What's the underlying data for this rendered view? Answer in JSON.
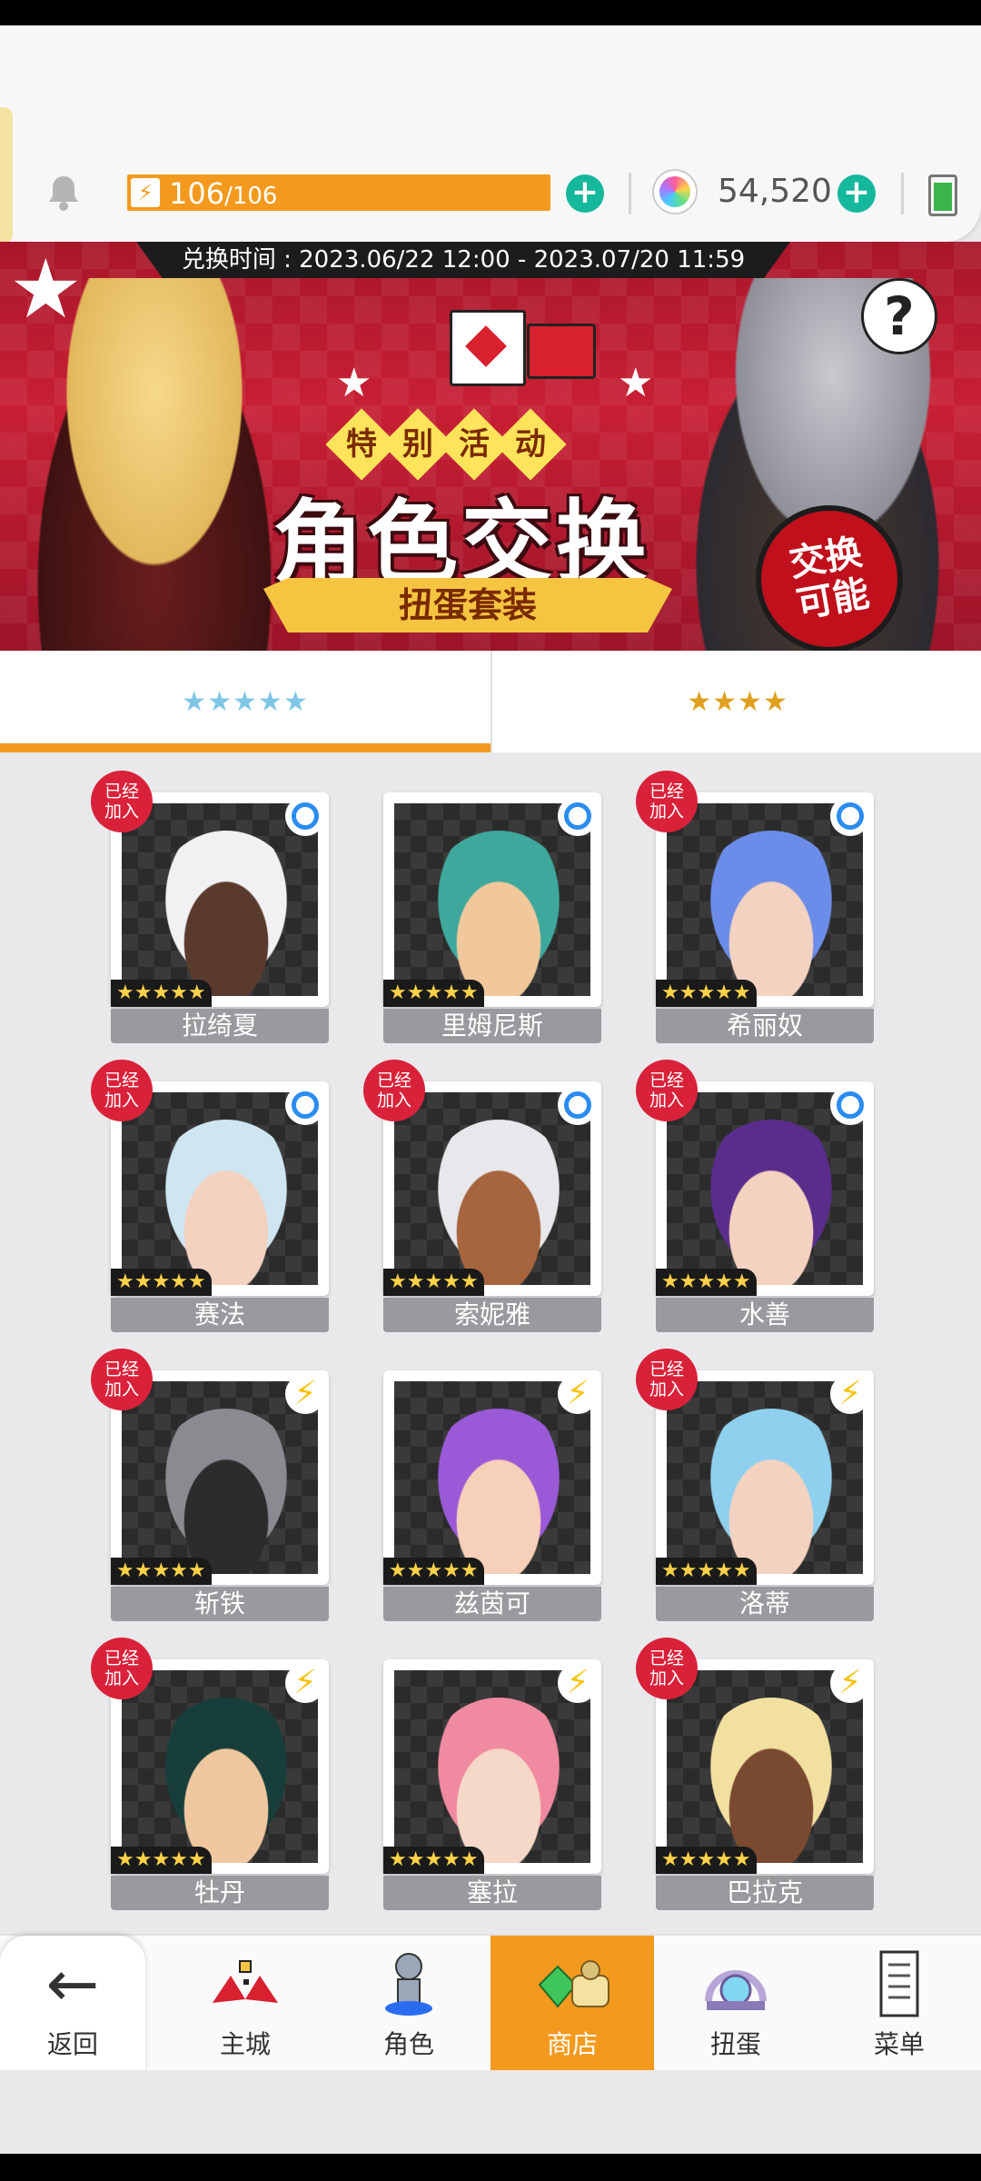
{
  "header": {
    "stamina_current": "106",
    "stamina_max": "/106",
    "gems": "54,520"
  },
  "banner": {
    "exchange_time": "兑换时间 : 2023.06/22 12:00 - 2023.07/20 11:59",
    "event_chars": [
      "特",
      "别",
      "活",
      "动"
    ],
    "title": "角色交换",
    "ribbon": "扭蛋套装",
    "stamp_line1": "交换",
    "stamp_line2": "可能"
  },
  "tabs": [
    {
      "label": "★★★★★"
    },
    {
      "label": "★★★★"
    }
  ],
  "cards": [
    {
      "name": "拉绮夏",
      "stars": "★★★★★",
      "joined": true,
      "type": "circle-icon"
    },
    {
      "name": "里姆尼斯",
      "stars": "★★★★★",
      "joined": false,
      "type": "circle-icon"
    },
    {
      "name": "希丽奴",
      "stars": "★★★★★",
      "joined": true,
      "type": "circle-icon"
    },
    {
      "name": "赛法",
      "stars": "★★★★★",
      "joined": true,
      "type": "circle-icon"
    },
    {
      "name": "索妮雅",
      "stars": "★★★★★",
      "joined": true,
      "type": "circle-icon"
    },
    {
      "name": "水善",
      "stars": "★★★★★",
      "joined": true,
      "type": "circle-icon"
    },
    {
      "name": "斩铁",
      "stars": "★★★★★",
      "joined": true,
      "type": "bolt-icon"
    },
    {
      "name": "兹茵可",
      "stars": "★★★★★",
      "joined": false,
      "type": "bolt-icon"
    },
    {
      "name": "洛蒂",
      "stars": "★★★★★",
      "joined": true,
      "type": "bolt-icon"
    },
    {
      "name": "牡丹",
      "stars": "★★★★★",
      "joined": true,
      "type": "bolt-icon"
    },
    {
      "name": "塞拉",
      "stars": "★★★★★",
      "joined": false,
      "type": "bolt-icon"
    },
    {
      "name": "巴拉克",
      "stars": "★★★★★",
      "joined": true,
      "type": "bolt-icon"
    }
  ],
  "badge": {
    "line1": "已经",
    "line2": "加入"
  },
  "nav": {
    "back": "返回",
    "items": [
      {
        "label": "主城"
      },
      {
        "label": "角色"
      },
      {
        "label": "商店"
      },
      {
        "label": "扭蛋"
      },
      {
        "label": "菜单"
      }
    ]
  }
}
